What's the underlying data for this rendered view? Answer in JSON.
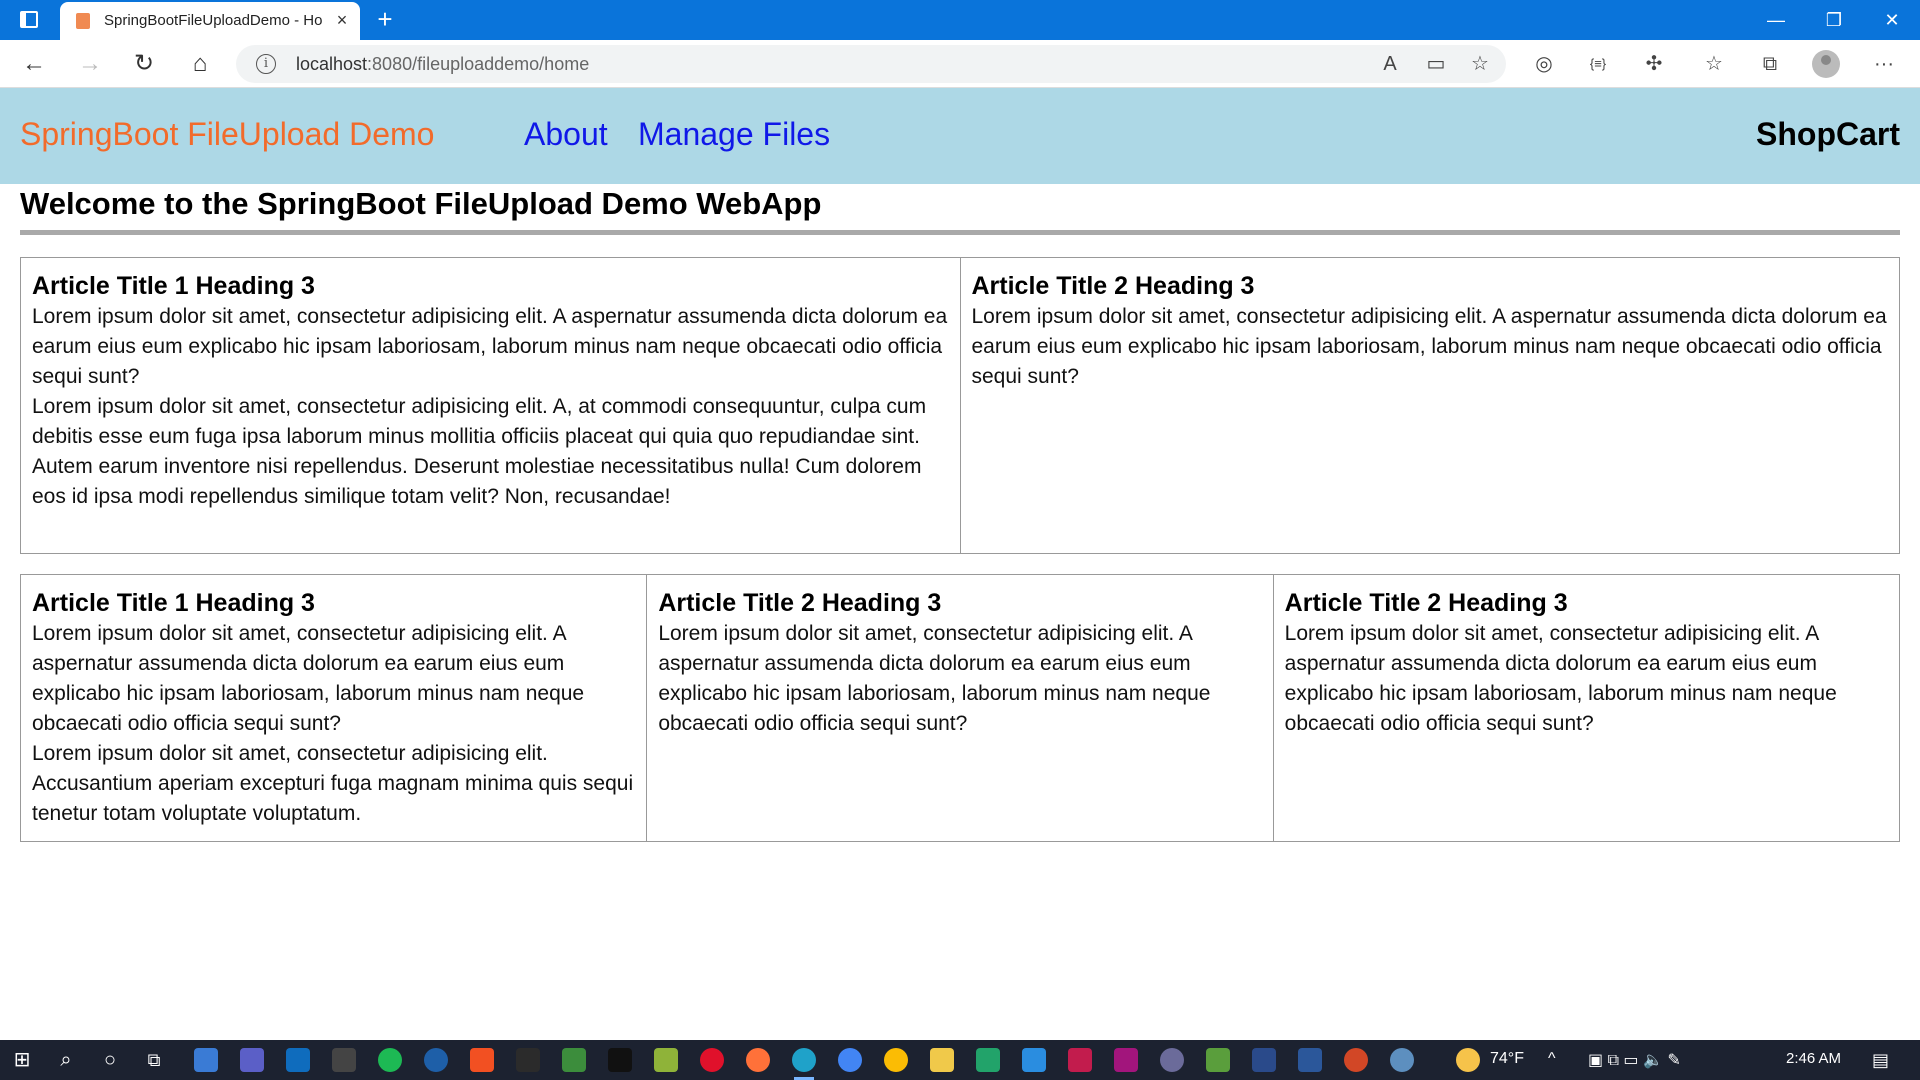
{
  "browser": {
    "tab_title": "SpringBootFileUploadDemo - Ho",
    "tab_close": "×",
    "new_tab": "+",
    "url_host": "localhost",
    "url_path": ":8080/fileuploaddemo/home",
    "back": "←",
    "forward": "→",
    "refresh": "↻",
    "home": "⌂",
    "minimize": "—",
    "restore": "❐",
    "close": "✕",
    "info": "i",
    "icons": {
      "read_aloud": "A",
      "immersive": "▭",
      "favorite_add": "☆",
      "browser_essentials": "◎",
      "code": "{≡}",
      "extensions": "✣",
      "favorites": "☆",
      "collections": "⧉",
      "more": "···"
    }
  },
  "site": {
    "brand": "SpringBoot FileUpload Demo",
    "nav": {
      "about": "About",
      "manage_files": "Manage Files"
    },
    "shopcart": "ShopCart",
    "page_title": "Welcome to the SpringBoot FileUpload Demo WebApp",
    "colors": {
      "header_bg": "#add8e6",
      "brand": "#f26b2b",
      "nav_link": "#1018e8"
    }
  },
  "row1": [
    {
      "title": "Article Title 1 Heading 3",
      "p1": "Lorem ipsum dolor sit amet, consectetur adipisicing elit. A aspernatur assumenda dicta dolorum ea earum eius eum explicabo hic ipsam laboriosam, laborum minus nam neque obcaecati odio officia sequi sunt?",
      "p2": "Lorem ipsum dolor sit amet, consectetur adipisicing elit. A, at commodi consequuntur, culpa cum debitis esse eum fuga ipsa laborum minus mollitia officiis placeat qui quia quo repudiandae sint. Autem earum inventore nisi repellendus. Deserunt molestiae necessitatibus nulla! Cum dolorem eos id ipsa modi repellendus similique totam velit? Non, recusandae!"
    },
    {
      "title": "Article Title 2 Heading 3",
      "p1": "Lorem ipsum dolor sit amet, consectetur adipisicing elit. A aspernatur assumenda dicta dolorum ea earum eius eum explicabo hic ipsam laboriosam, laborum minus nam neque obcaecati odio officia sequi sunt?"
    }
  ],
  "row2": [
    {
      "title": "Article Title 1 Heading 3",
      "p1": "Lorem ipsum dolor sit amet, consectetur adipisicing elit. A aspernatur assumenda dicta dolorum ea earum eius eum explicabo hic ipsam laboriosam, laborum minus nam neque obcaecati odio officia sequi sunt?",
      "p2": "Lorem ipsum dolor sit amet, consectetur adipisicing elit. Accusantium aperiam excepturi fuga magnam minima quis sequi tenetur totam voluptate voluptatum."
    },
    {
      "title": "Article Title 2 Heading 3",
      "p1": "Lorem ipsum dolor sit amet, consectetur adipisicing elit. A aspernatur assumenda dicta dolorum ea earum eius eum explicabo hic ipsam laboriosam, laborum minus nam neque obcaecati odio officia sequi sunt?"
    },
    {
      "title": "Article Title 2 Heading 3",
      "p1": "Lorem ipsum dolor sit amet, consectetur adipisicing elit. A aspernatur assumenda dicta dolorum ea earum eius eum explicabo hic ipsam laboriosam, laborum minus nam neque obcaecati odio officia sequi sunt?"
    }
  ],
  "taskbar": {
    "weather": "74°F",
    "time": "2:46 AM",
    "start": "⊞",
    "search": "⌕",
    "cortana": "○",
    "taskview": "⧉",
    "tray_up": "^",
    "notifications": "▤"
  }
}
